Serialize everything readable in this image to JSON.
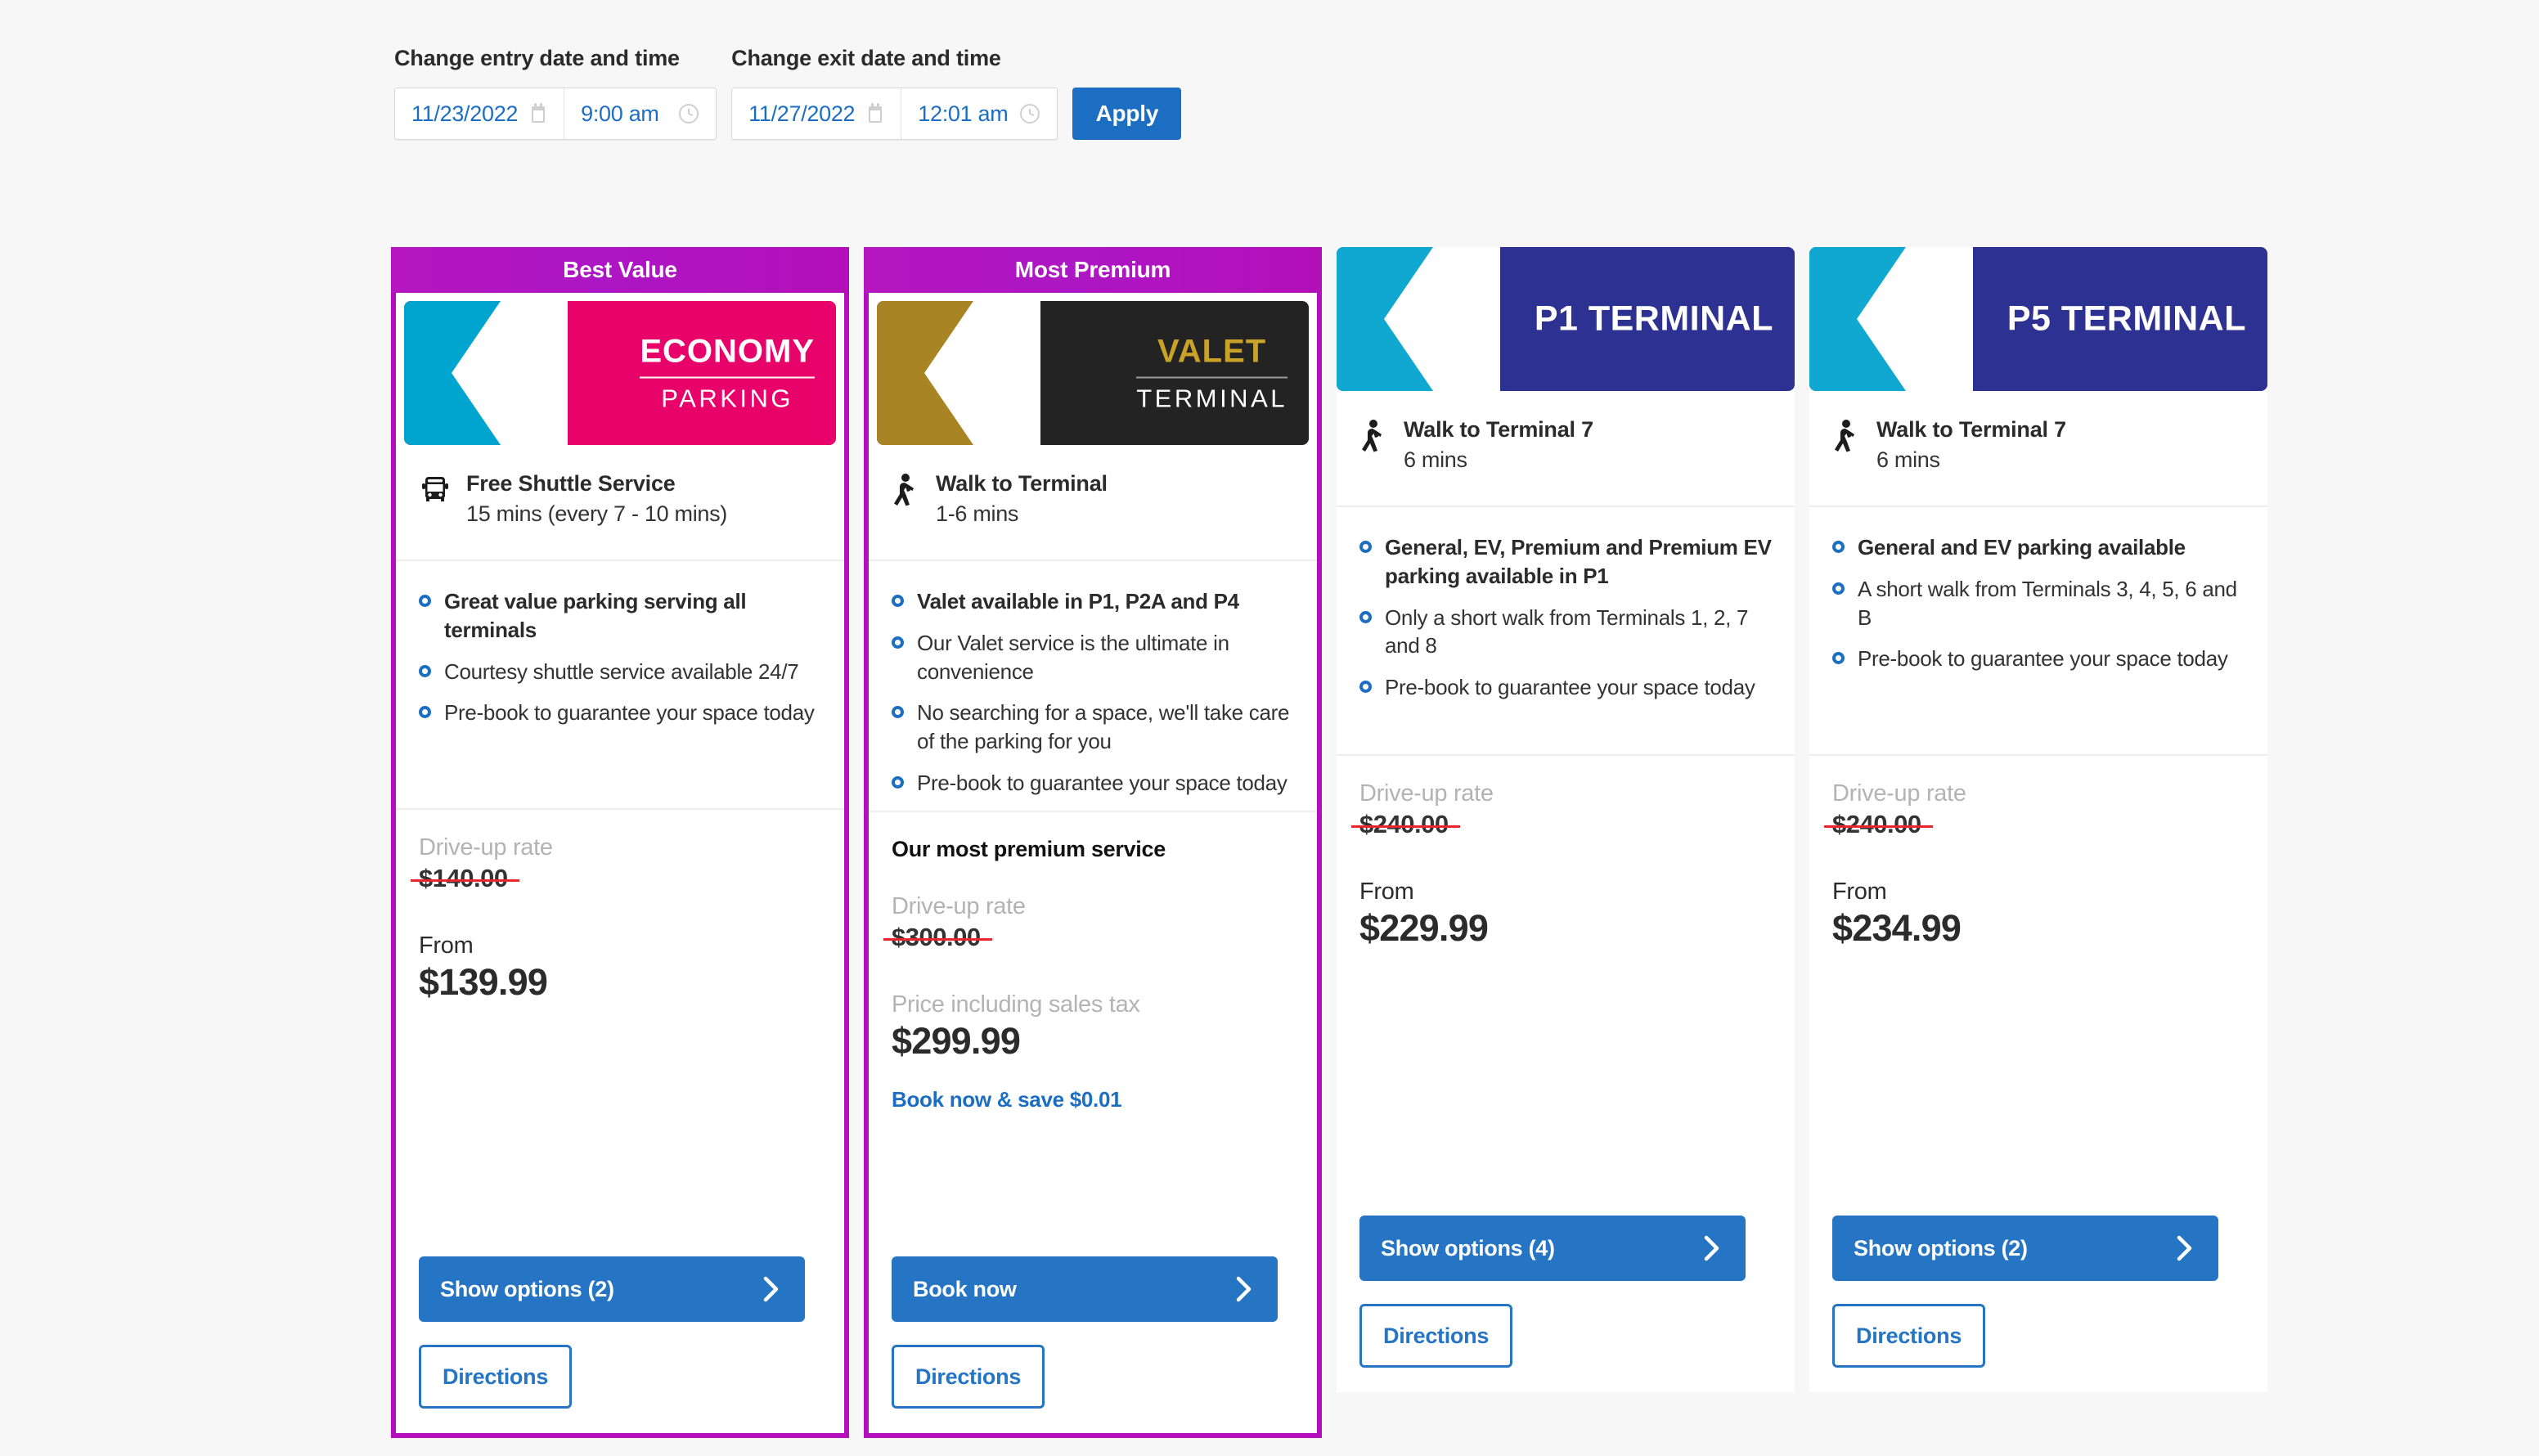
{
  "search": {
    "entry_label": "Change entry date and time",
    "exit_label": "Change exit date and time",
    "entry_date": "11/23/2022",
    "entry_time": "9:00 am",
    "exit_date": "11/27/2022",
    "exit_time": "12:01 am",
    "apply_label": "Apply",
    "accent_color": "#1b6ec2"
  },
  "cards": [
    {
      "ribbon": "Best Value",
      "ribbon_color": "#b516bf",
      "logo": {
        "style": "two-line",
        "main": "ECONOMY",
        "sub": "PARKING",
        "bg_color": "#e8036b",
        "chevron_color": "#00a5cf",
        "text_color": "#ffffff"
      },
      "transit": {
        "icon": "bus-icon",
        "title": "Free Shuttle Service",
        "sub": "15 mins (every 7 - 10 mins)"
      },
      "features": [
        {
          "text": "Great value parking serving all terminals",
          "bold": true
        },
        {
          "text": "Courtesy shuttle service available 24/7",
          "bold": false
        },
        {
          "text": "Pre-book to guarantee your space today",
          "bold": false
        }
      ],
      "premium_tag": "",
      "driveup_label": "Drive-up rate",
      "driveup_price": "$140.00",
      "from_label": "From",
      "price": "$139.99",
      "save_text": "",
      "primary_label": "Show options (2)",
      "secondary_label": "Directions"
    },
    {
      "ribbon": "Most Premium",
      "ribbon_color": "#b516bf",
      "logo": {
        "style": "two-line",
        "main": "VALET",
        "sub": "TERMINAL",
        "bg_color": "#232323",
        "chevron_color": "#a88425",
        "text_color": "#c9a227"
      },
      "transit": {
        "icon": "walk-icon",
        "title": "Walk to Terminal",
        "sub": "1-6 mins"
      },
      "features": [
        {
          "text": "Valet available in P1, P2A and P4",
          "bold": true
        },
        {
          "text": "Our Valet service is the ultimate in convenience",
          "bold": false
        },
        {
          "text": "No searching for a space, we'll take care of the parking for you",
          "bold": false
        },
        {
          "text": "Pre-book to guarantee your space today",
          "bold": false
        }
      ],
      "premium_tag": "Our most premium service",
      "driveup_label": "Drive-up rate",
      "driveup_price": "$300.00",
      "from_label": "Price including sales tax",
      "price": "$299.99",
      "save_text": "Book now & save $0.01",
      "primary_label": "Book now",
      "secondary_label": "Directions"
    },
    {
      "ribbon": "",
      "logo": {
        "style": "single",
        "main": "P1 TERMINAL",
        "sub": "",
        "bg_color": "#2d3192",
        "chevron_color": "#10a7d0",
        "text_color": "#ffffff"
      },
      "transit": {
        "icon": "walk-icon",
        "title": "Walk to Terminal 7",
        "sub": "6 mins"
      },
      "features": [
        {
          "text": "General, EV, Premium and Premium EV parking available in P1",
          "bold": true
        },
        {
          "text": "Only a short walk from Terminals 1, 2, 7 and 8",
          "bold": false
        },
        {
          "text": "Pre-book to guarantee your space today",
          "bold": false
        }
      ],
      "premium_tag": "",
      "driveup_label": "Drive-up rate",
      "driveup_price": "$240.00",
      "from_label": "From",
      "price": "$229.99",
      "save_text": "",
      "primary_label": "Show options (4)",
      "secondary_label": "Directions"
    },
    {
      "ribbon": "",
      "logo": {
        "style": "single",
        "main": "P5 TERMINAL",
        "sub": "",
        "bg_color": "#2d3192",
        "chevron_color": "#10a7d0",
        "text_color": "#ffffff"
      },
      "transit": {
        "icon": "walk-icon",
        "title": "Walk to Terminal 7",
        "sub": "6 mins"
      },
      "features": [
        {
          "text": "General and EV parking available",
          "bold": true
        },
        {
          "text": "A short walk from Terminals 3, 4, 5, 6 and B",
          "bold": false
        },
        {
          "text": "Pre-book to guarantee your space today",
          "bold": false
        }
      ],
      "premium_tag": "",
      "driveup_label": "Drive-up rate",
      "driveup_price": "$240.00",
      "from_label": "From",
      "price": "$234.99",
      "save_text": "",
      "primary_label": "Show options (2)",
      "secondary_label": "Directions"
    }
  ]
}
